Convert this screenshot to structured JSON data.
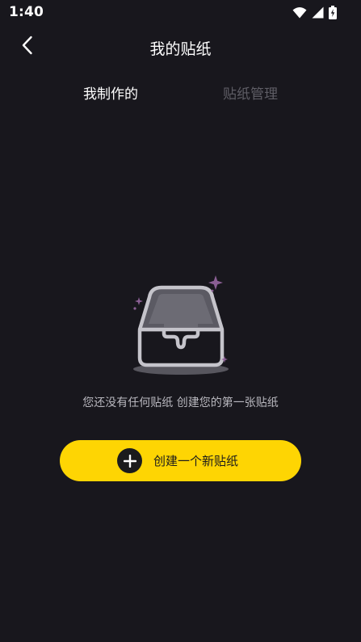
{
  "status_bar": {
    "time": "1:40",
    "icons": [
      "wifi-icon",
      "cellular-signal-icon",
      "battery-charging-icon"
    ]
  },
  "nav": {
    "back_icon": "chevron-left-icon",
    "title": "我的贴纸"
  },
  "tabs": [
    {
      "label": "我制作的",
      "active": true
    },
    {
      "label": "贴纸管理",
      "active": false
    }
  ],
  "empty_state": {
    "illustration": "empty-box-icon",
    "message": "您还没有任何贴纸 创建您的第一张贴纸"
  },
  "create_button": {
    "icon": "plus-icon",
    "label": "创建一个新贴纸"
  },
  "colors": {
    "background": "#18171d",
    "accent": "#fed503",
    "tab_inactive": "#5e5d65",
    "sparkle": "#8a5f94"
  }
}
